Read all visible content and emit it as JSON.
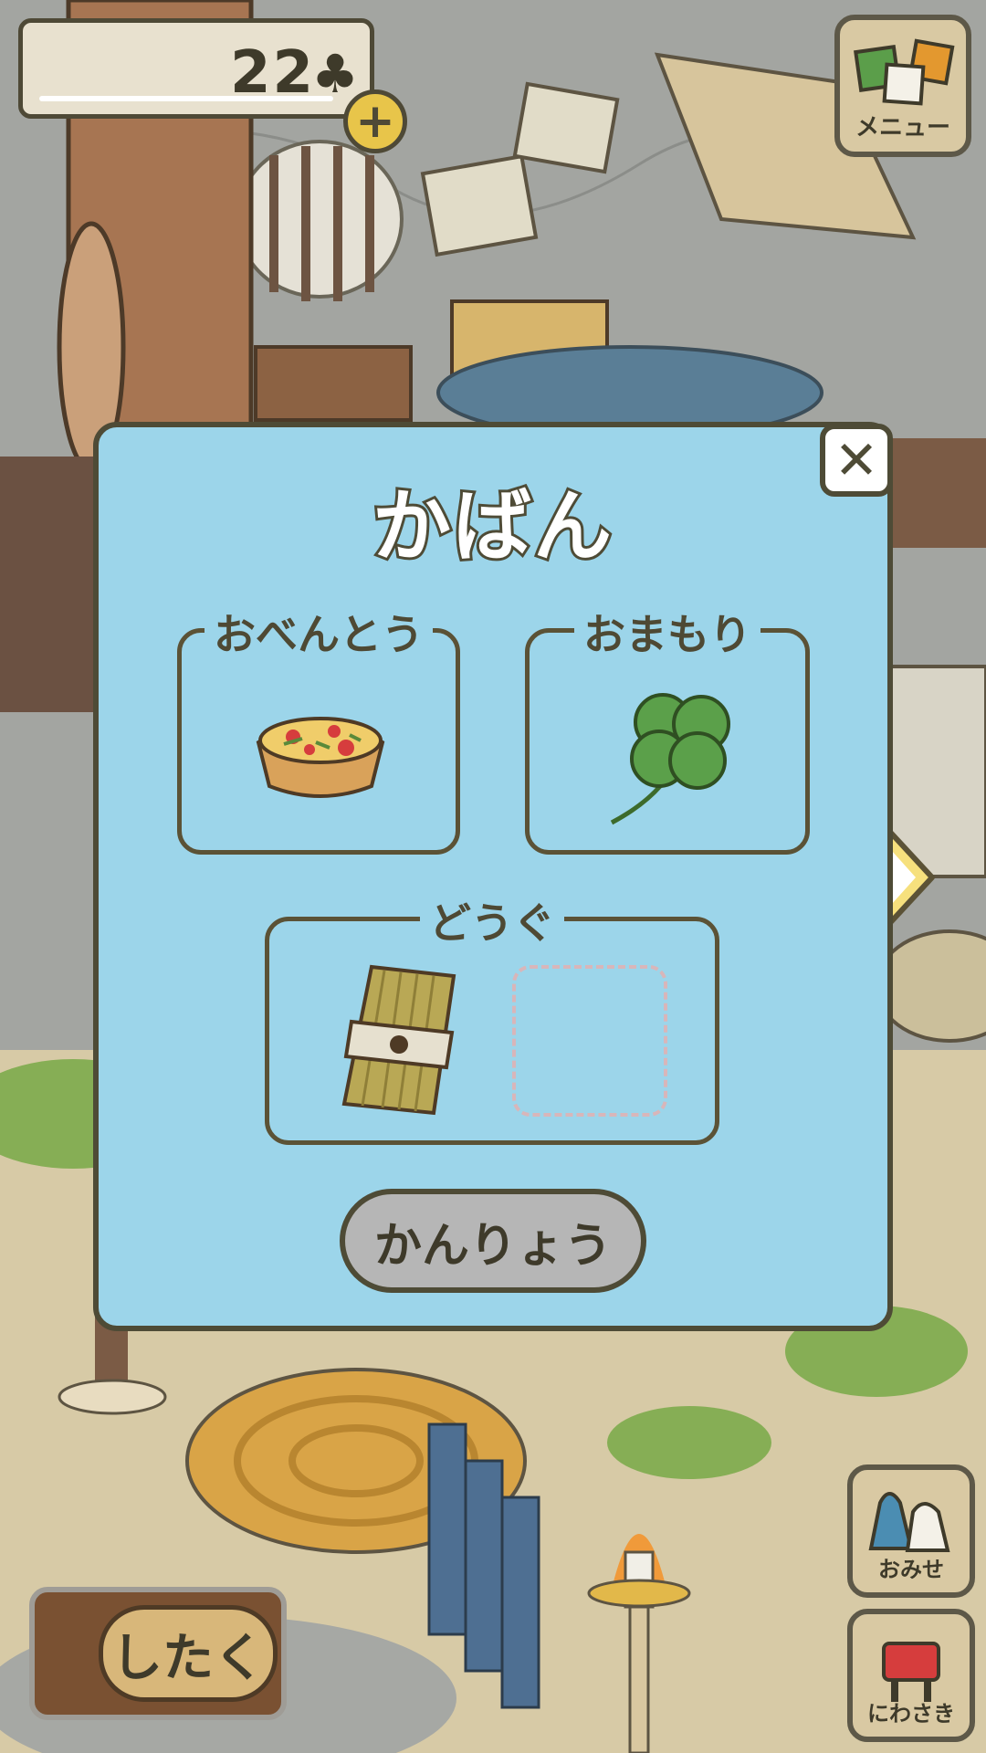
{
  "hud": {
    "clover_count": "22",
    "clover_symbol": "♣",
    "plus_label": "+"
  },
  "menu": {
    "label": "メニュー",
    "icon": "cards-icon"
  },
  "side_buttons": [
    {
      "label": "おみせ",
      "icon": "shop-bags-icon"
    },
    {
      "label": "にわさき",
      "icon": "mailbox-icon"
    }
  ],
  "pack_button": {
    "label": "したく"
  },
  "modal": {
    "title": "かばん",
    "close_label": "✕",
    "sections": {
      "lunch": {
        "label": "おべんとう",
        "item": "quiche"
      },
      "charm": {
        "label": "おまもり",
        "item": "four-leaf-clover"
      },
      "tools": {
        "label": "どうぐ",
        "items": [
          "straw-bundle"
        ],
        "empty_slots": 1
      }
    },
    "done_label": "かんりょう"
  },
  "colors": {
    "modal_bg": "#9cd5ea",
    "outline": "#4e4b36",
    "button_gray": "#b6b6b6"
  }
}
